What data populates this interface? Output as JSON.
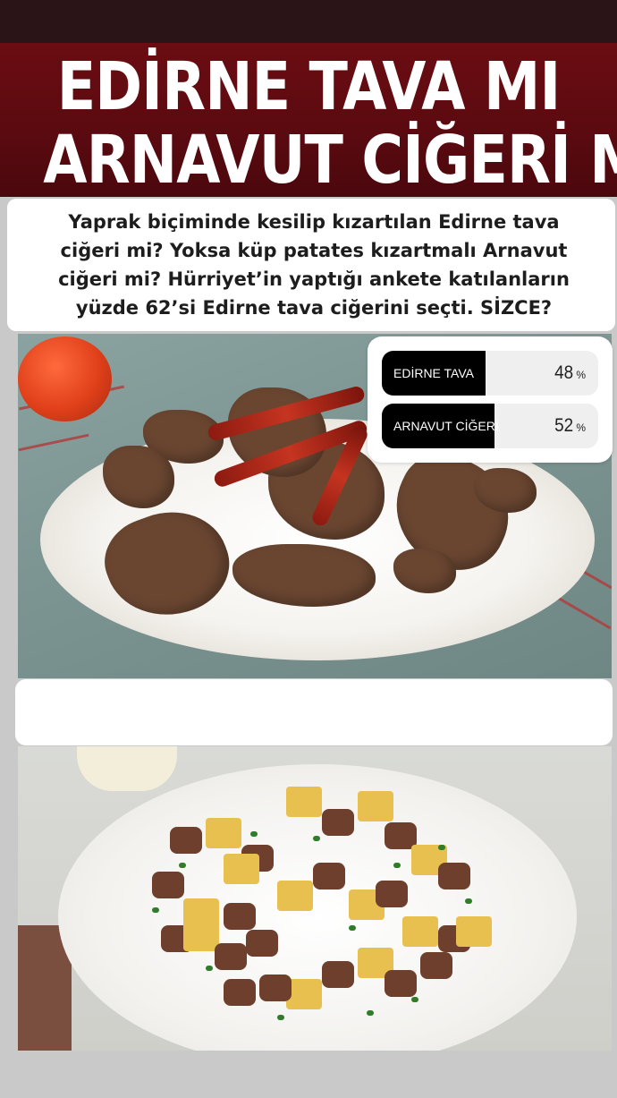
{
  "headline": {
    "line1": "EDİRNE TAVA MI",
    "line2": "ARNAVUT CİĞERİ Mİ"
  },
  "subtitle": {
    "lines": [
      "Yaprak biçiminde kesilip kızartılan Edirne tava",
      "ciğeri mi? Yoksa küp patates kızartmalı Arnavut",
      "ciğeri mi? Hürriyet’in yaptığı ankete katılanların",
      "yüzde 62’si Edirne tava ciğerini seçti. SİZCE?"
    ]
  },
  "poll": {
    "options": [
      {
        "label": "EDİRNE TAVA",
        "percent": "48",
        "symbol": "%",
        "value": 48
      },
      {
        "label": "ARNAVUT CİĞERİ",
        "percent": "52",
        "symbol": "%",
        "value": 52
      }
    ]
  },
  "colors": {
    "headline_bg": "#5a0a10",
    "poll_fill": "#000000",
    "poll_track": "#efefef"
  },
  "icons": {
    "photo1": "edirne-liver-plate-image",
    "photo2": "albanian-liver-plate-image"
  }
}
